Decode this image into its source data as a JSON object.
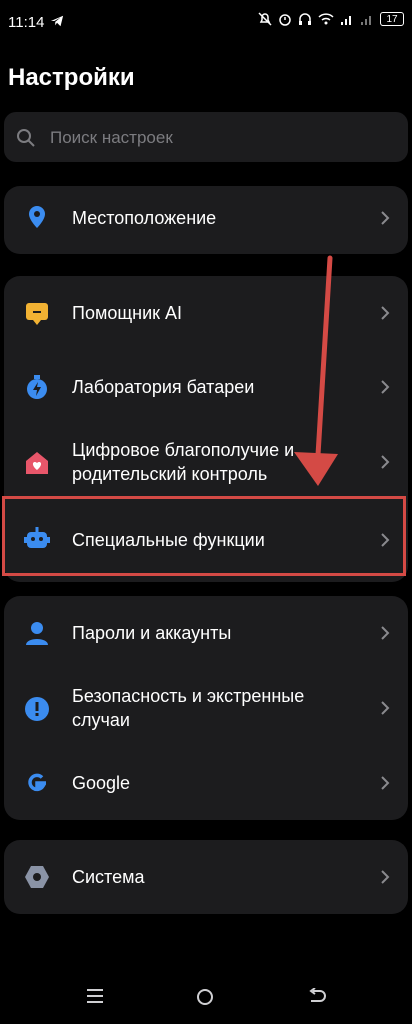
{
  "status_bar": {
    "time": "11:14",
    "battery": "17"
  },
  "header": {
    "title": "Настройки"
  },
  "search": {
    "placeholder": "Поиск настроек"
  },
  "items": {
    "location": "Местоположение",
    "assistant": "Помощник AI",
    "battery_lab": "Лаборатория батареи",
    "wellbeing": "Цифровое благополучие и родительский контроль",
    "accessibility": "Специальные функции",
    "passwords": "Пароли и аккаунты",
    "safety": "Безопасность и экстренные случаи",
    "google": "Google",
    "system": "Система"
  },
  "colors": {
    "background": "#000000",
    "card": "#1c1c1e",
    "accent_blue": "#3b8cf0",
    "highlight_red": "#d44a45"
  },
  "icons": [
    "location-icon",
    "assistant-icon",
    "battery-icon",
    "wellbeing-icon",
    "accessibility-icon",
    "account-icon",
    "safety-icon",
    "google-icon",
    "system-icon"
  ]
}
